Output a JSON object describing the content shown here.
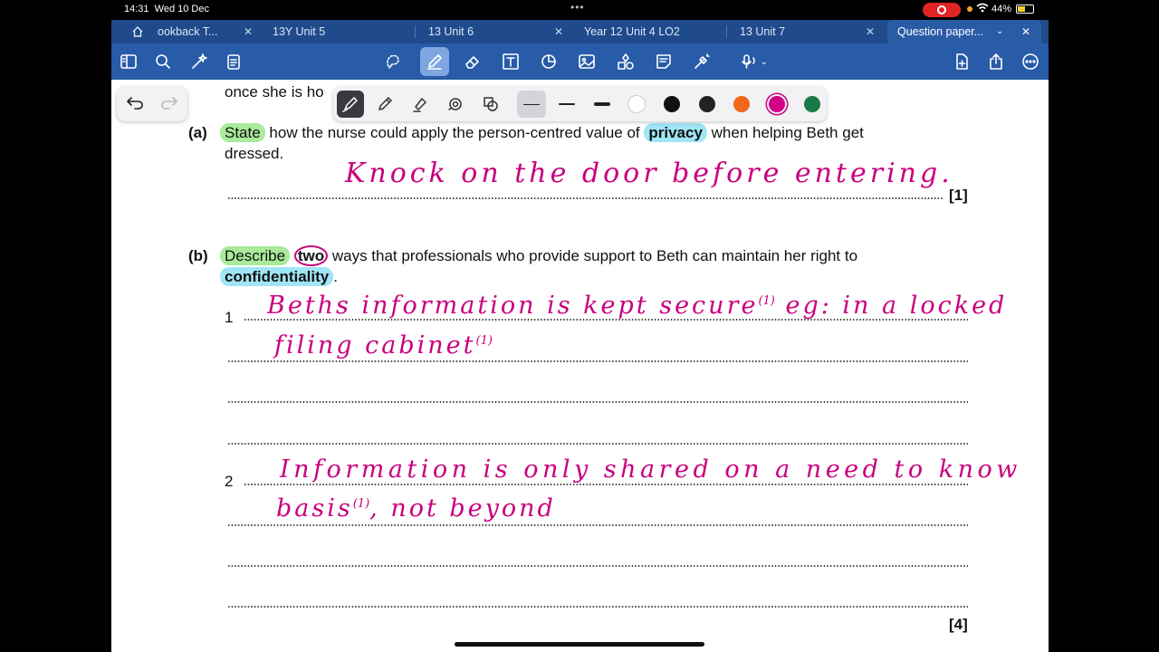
{
  "status": {
    "time": "14:31",
    "date": "Wed 10 Dec",
    "battery": "44%"
  },
  "tabs": [
    {
      "label": "ookback T...",
      "active": false
    },
    {
      "label": "13Y Unit 5",
      "active": false
    },
    {
      "label": "13 Unit 6",
      "active": false
    },
    {
      "label": "Year 12 Unit 4 LO2",
      "active": false
    },
    {
      "label": "13 Unit 7",
      "active": false
    },
    {
      "label": "Question paper...",
      "active": true
    }
  ],
  "toolbar": {
    "left": [
      "sidebar-icon",
      "search-icon",
      "magic-icon",
      "clipboard-icon"
    ],
    "center": [
      "lasso-icon",
      "pen-icon",
      "eraser-icon",
      "text-icon",
      "shapes-icon",
      "image-icon",
      "stickers-icon",
      "note-icon",
      "laser-icon",
      "mic-icon"
    ],
    "right": [
      "add-page-icon",
      "share-icon",
      "more-icon"
    ]
  },
  "pen_palette": {
    "tools": [
      "pen-icon",
      "highlighter-icon",
      "brush-icon",
      "shape-pen-icon",
      "stamp-icon"
    ],
    "widths": [
      "fine",
      "medium",
      "thick"
    ],
    "colors": [
      "#ffffff",
      "#111111",
      "#222222",
      "#f2661c",
      "#d4008a",
      "#1a7a45"
    ],
    "selected_color": "#d4008a"
  },
  "document": {
    "partial_line": "once she is ho",
    "a": {
      "label": "(a)",
      "q_state": "State",
      "q_mid": " how the nurse could apply the person-centred value of ",
      "q_privacy": "privacy",
      "q_end": " when helping Beth get",
      "q_line2": "dressed.",
      "answer": "Knock on the door before entering.",
      "marks": "[1]"
    },
    "b": {
      "label": "(b)",
      "q_describe": "Describe",
      "q_two": "two",
      "q_mid": " ways that professionals who provide support to Beth can maintain her right to",
      "q_conf": "confidentiality",
      "q_period": ".",
      "num1": "1",
      "num2": "2",
      "ans1_line1": "Beths information is kept secure",
      "ans1_mark1": "(1)",
      "ans1_line1b": "eg: in a locked",
      "ans1_line2": "filing cabinet",
      "ans1_mark2": "(1)",
      "ans2_line1": "Information is only shared on a need to know",
      "ans2_line2a": "basis",
      "ans2_mark": "(1)",
      "ans2_line2b": ", not beyond",
      "marks": "[4]"
    }
  }
}
